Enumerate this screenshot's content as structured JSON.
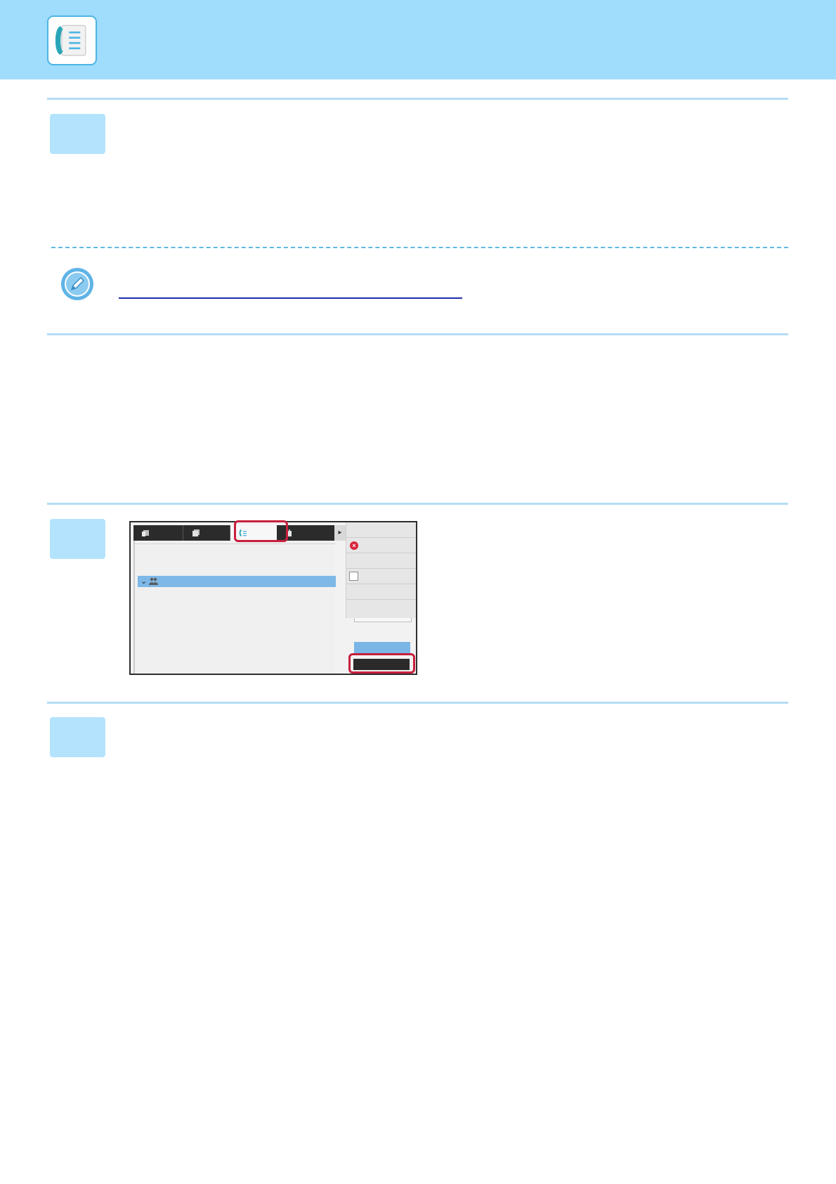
{
  "header": {
    "icon": "fax-address-book-icon",
    "band_color": "#a0dcfb",
    "accent_color": "#4cb5e5"
  },
  "steps": [
    {
      "number": ""
    },
    {
      "number": ""
    },
    {
      "number": ""
    }
  ],
  "note": {
    "icon": "pencil-note-icon",
    "link_text": "",
    "link_color": "#1e2ea8"
  },
  "screenshot": {
    "tabs": [
      {
        "icon": "scan-tab-icon",
        "label": ""
      },
      {
        "icon": "job-tab-icon",
        "label": ""
      },
      {
        "icon": "fax-tab-icon",
        "label": "",
        "active": true
      },
      {
        "icon": "internet-fax-tab-icon",
        "label": ""
      }
    ],
    "selected_row": {
      "icon": "group-users-icon",
      "label": ""
    },
    "side_menu": [
      {
        "icon": "",
        "label": ""
      },
      {
        "icon": "cancel-icon",
        "label": ""
      },
      {
        "icon": "",
        "label": ""
      },
      {
        "icon": "checkbox-icon",
        "label": ""
      },
      {
        "icon": "",
        "label": ""
      }
    ],
    "highlight_color": "#c81f3c"
  }
}
